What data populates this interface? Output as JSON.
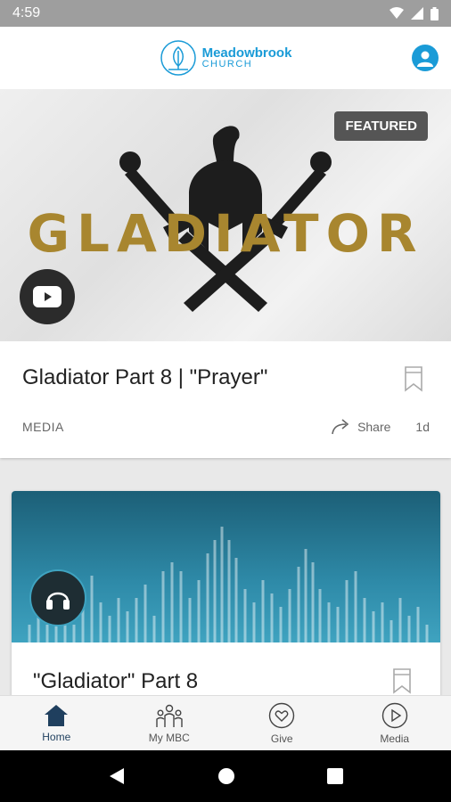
{
  "status": {
    "time": "4:59"
  },
  "header": {
    "logo_name": "Meadowbrook",
    "logo_sub": "CHURCH"
  },
  "featured_card": {
    "hero_title": "GLADIATOR",
    "badge": "FEATURED",
    "title": "Gladiator Part 8 | \"Prayer\"",
    "category": "MEDIA",
    "share_label": "Share",
    "age": "1d"
  },
  "second_card": {
    "title": "\"Gladiator\" Part 8"
  },
  "bottom_nav": {
    "items": [
      {
        "label": "Home",
        "icon": "home-icon"
      },
      {
        "label": "My MBC",
        "icon": "people-icon"
      },
      {
        "label": "Give",
        "icon": "heart-icon"
      },
      {
        "label": "Media",
        "icon": "play-icon"
      }
    ]
  },
  "colors": {
    "brand": "#1a9bd7",
    "gold": "#a8862f",
    "nav_active": "#1f3f5e"
  }
}
